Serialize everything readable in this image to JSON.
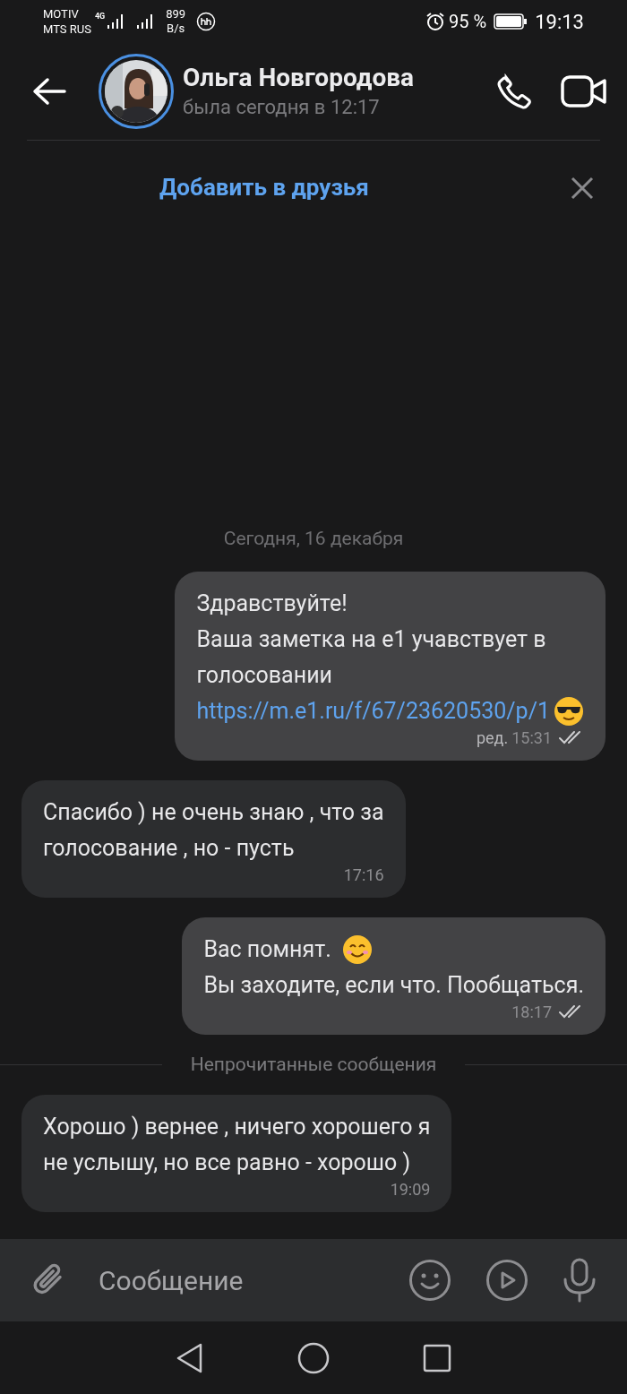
{
  "status_bar": {
    "carrier_1": "MOTIV",
    "carrier_2": "MTS RUS",
    "network": "4G",
    "speed": "899",
    "speed_unit": "B/s",
    "battery": "95 %",
    "time": "19:13"
  },
  "header": {
    "name": "Ольга Новгородова",
    "last_seen": "была сегодня в 12:17"
  },
  "friend_bar": {
    "label": "Добавить в друзья"
  },
  "chat": [
    {
      "kind": "date",
      "text": "Сегодня, 16 декабря"
    },
    {
      "kind": "message",
      "outgoing": true,
      "read": true,
      "lines": [
        [
          {
            "kind": "text",
            "text": "Здравствуйте!"
          }
        ],
        [
          {
            "kind": "text",
            "text": "Ваша заметка на е1 учавствует в"
          }
        ],
        [
          {
            "kind": "text",
            "text": "голосовании"
          }
        ],
        [
          {
            "kind": "link",
            "text": "https://m.e1.ru/f/67/23620530/p/1"
          },
          {
            "kind": "sunglasses_emoji"
          }
        ]
      ],
      "edited_label": "ред.",
      "time": "15:31"
    },
    {
      "kind": "message",
      "outgoing": false,
      "read": false,
      "lines": [
        [
          {
            "kind": "text",
            "text": "Спасибо ) не очень знаю , что за"
          }
        ],
        [
          {
            "kind": "text",
            "text": "голосование , но - пусть"
          }
        ]
      ],
      "time": "17:16"
    },
    {
      "kind": "message",
      "outgoing": true,
      "read": true,
      "lines": [
        [
          {
            "kind": "text",
            "text": "Вас помнят."
          },
          {
            "kind": "smile_emoji"
          }
        ],
        [
          {
            "kind": "text",
            "text": "Вы заходите, если что. Пообщаться."
          }
        ]
      ],
      "time": "18:17"
    },
    {
      "kind": "divider",
      "text": "Непрочитанные сообщения"
    },
    {
      "kind": "message",
      "outgoing": false,
      "read": false,
      "lines": [
        [
          {
            "kind": "text",
            "text": "Хорошо ) вернее , ничего хорошего я"
          }
        ],
        [
          {
            "kind": "text",
            "text": "не услышу, но все равно - хорошо )"
          }
        ]
      ],
      "time": "19:09"
    }
  ],
  "composer": {
    "placeholder": "Сообщение"
  }
}
